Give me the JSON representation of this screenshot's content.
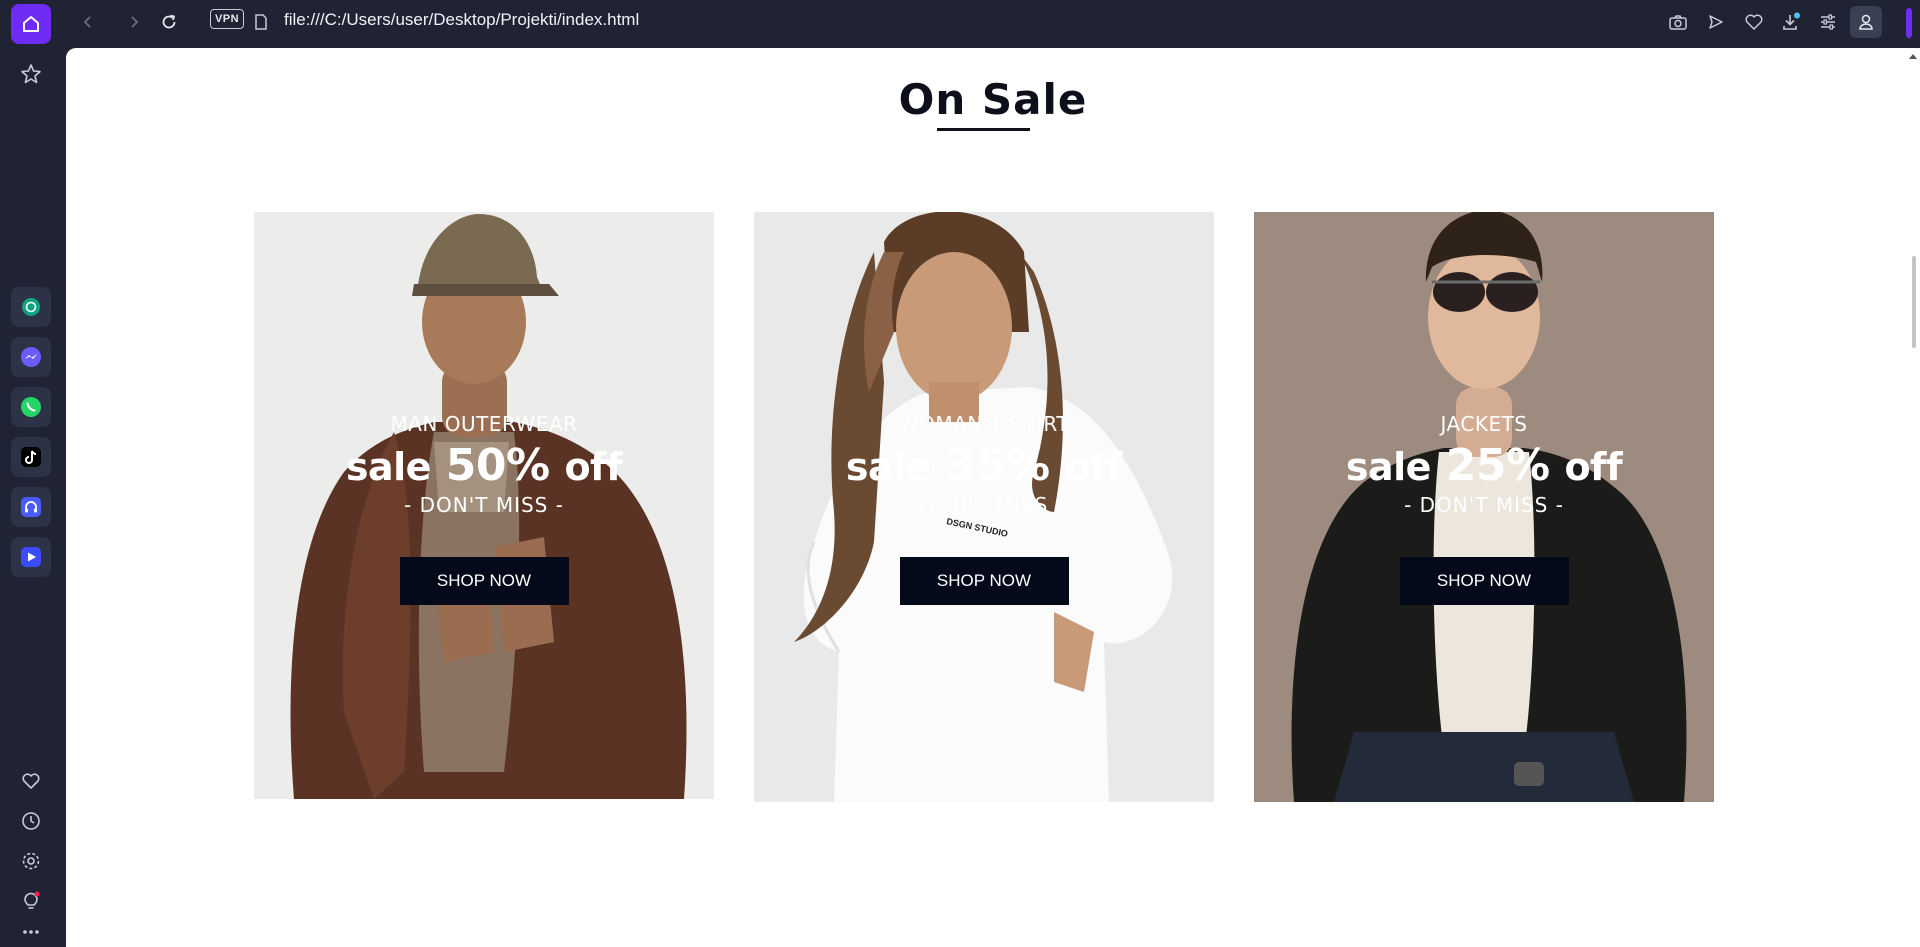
{
  "browser": {
    "url": "file:///C:/Users/user/Desktop/Projekti/index.html",
    "vpn_label": "VPN"
  },
  "page": {
    "heading": "On Sale",
    "cards": [
      {
        "category": "MAN OUTERWEAR",
        "sale_prefix": "sale",
        "percent": "50%",
        "sale_suffix": "off",
        "tagline": "- DON'T MISS -",
        "button": "SHOP NOW"
      },
      {
        "category": "WOMAN T-SHIRT",
        "sale_prefix": "sale",
        "percent": "35%",
        "sale_suffix": "off",
        "tagline": "- DON'T MISS -",
        "button": "SHOP NOW"
      },
      {
        "category": "JACKETS",
        "sale_prefix": "sale",
        "percent": "25%",
        "sale_suffix": "off",
        "tagline": "- DON'T MISS -",
        "button": "SHOP NOW"
      }
    ]
  },
  "colors": {
    "accent": "#6f2cf7",
    "button_bg": "#050a1a",
    "chrome_bg": "#1f2333"
  }
}
